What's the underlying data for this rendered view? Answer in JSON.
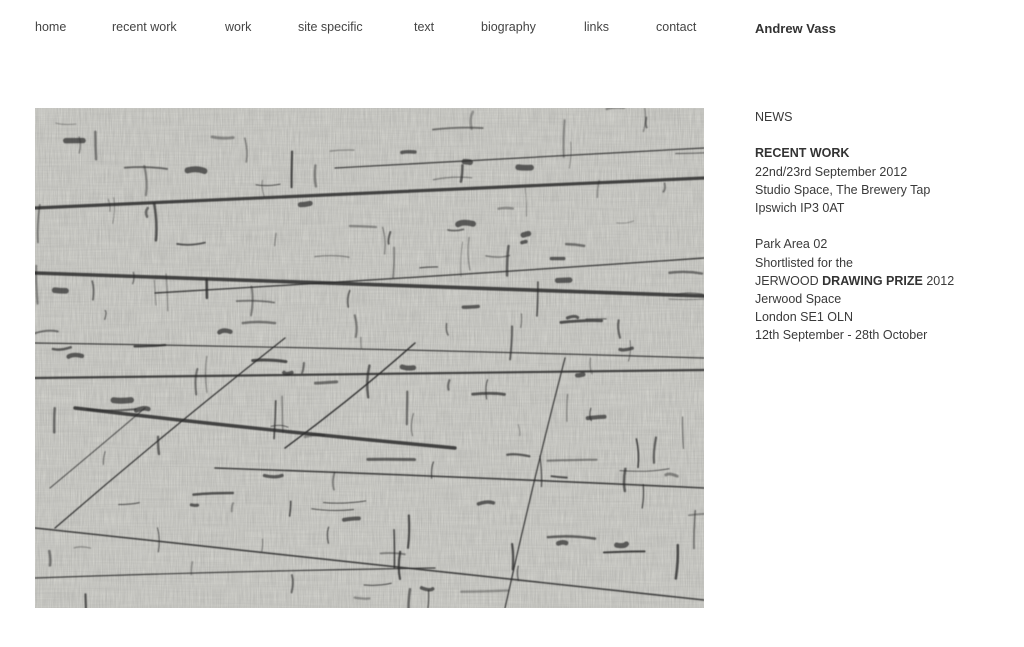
{
  "nav": {
    "items": [
      {
        "label": "home"
      },
      {
        "label": "recent work"
      },
      {
        "label": "work"
      },
      {
        "label": "site specific"
      },
      {
        "label": "text"
      },
      {
        "label": "biography"
      },
      {
        "label": "links"
      },
      {
        "label": "contact"
      }
    ]
  },
  "site_name": "Andrew Vass",
  "sidebar": {
    "news_heading": "NEWS",
    "recent_work_heading": "RECENT WORK",
    "recent_work_dates": "22nd/23rd September 2012",
    "recent_work_venue": "Studio Space, The Brewery Tap",
    "recent_work_address": "Ipswich IP3 0AT",
    "prize_title": "Park Area 02",
    "prize_shortlist": "Shortlisted for the",
    "prize_org": "JERWOOD",
    "prize_name": "DRAWING PRIZE",
    "prize_year": "2012",
    "prize_venue": "Jerwood Space",
    "prize_address": "London SE1 OLN",
    "prize_dates": "12th September - 28th October"
  },
  "colors": {
    "background": "#ffffff",
    "text": "#333333",
    "artwork_base": "#dcdcd6",
    "artwork_ink": "#2a2a2a"
  }
}
